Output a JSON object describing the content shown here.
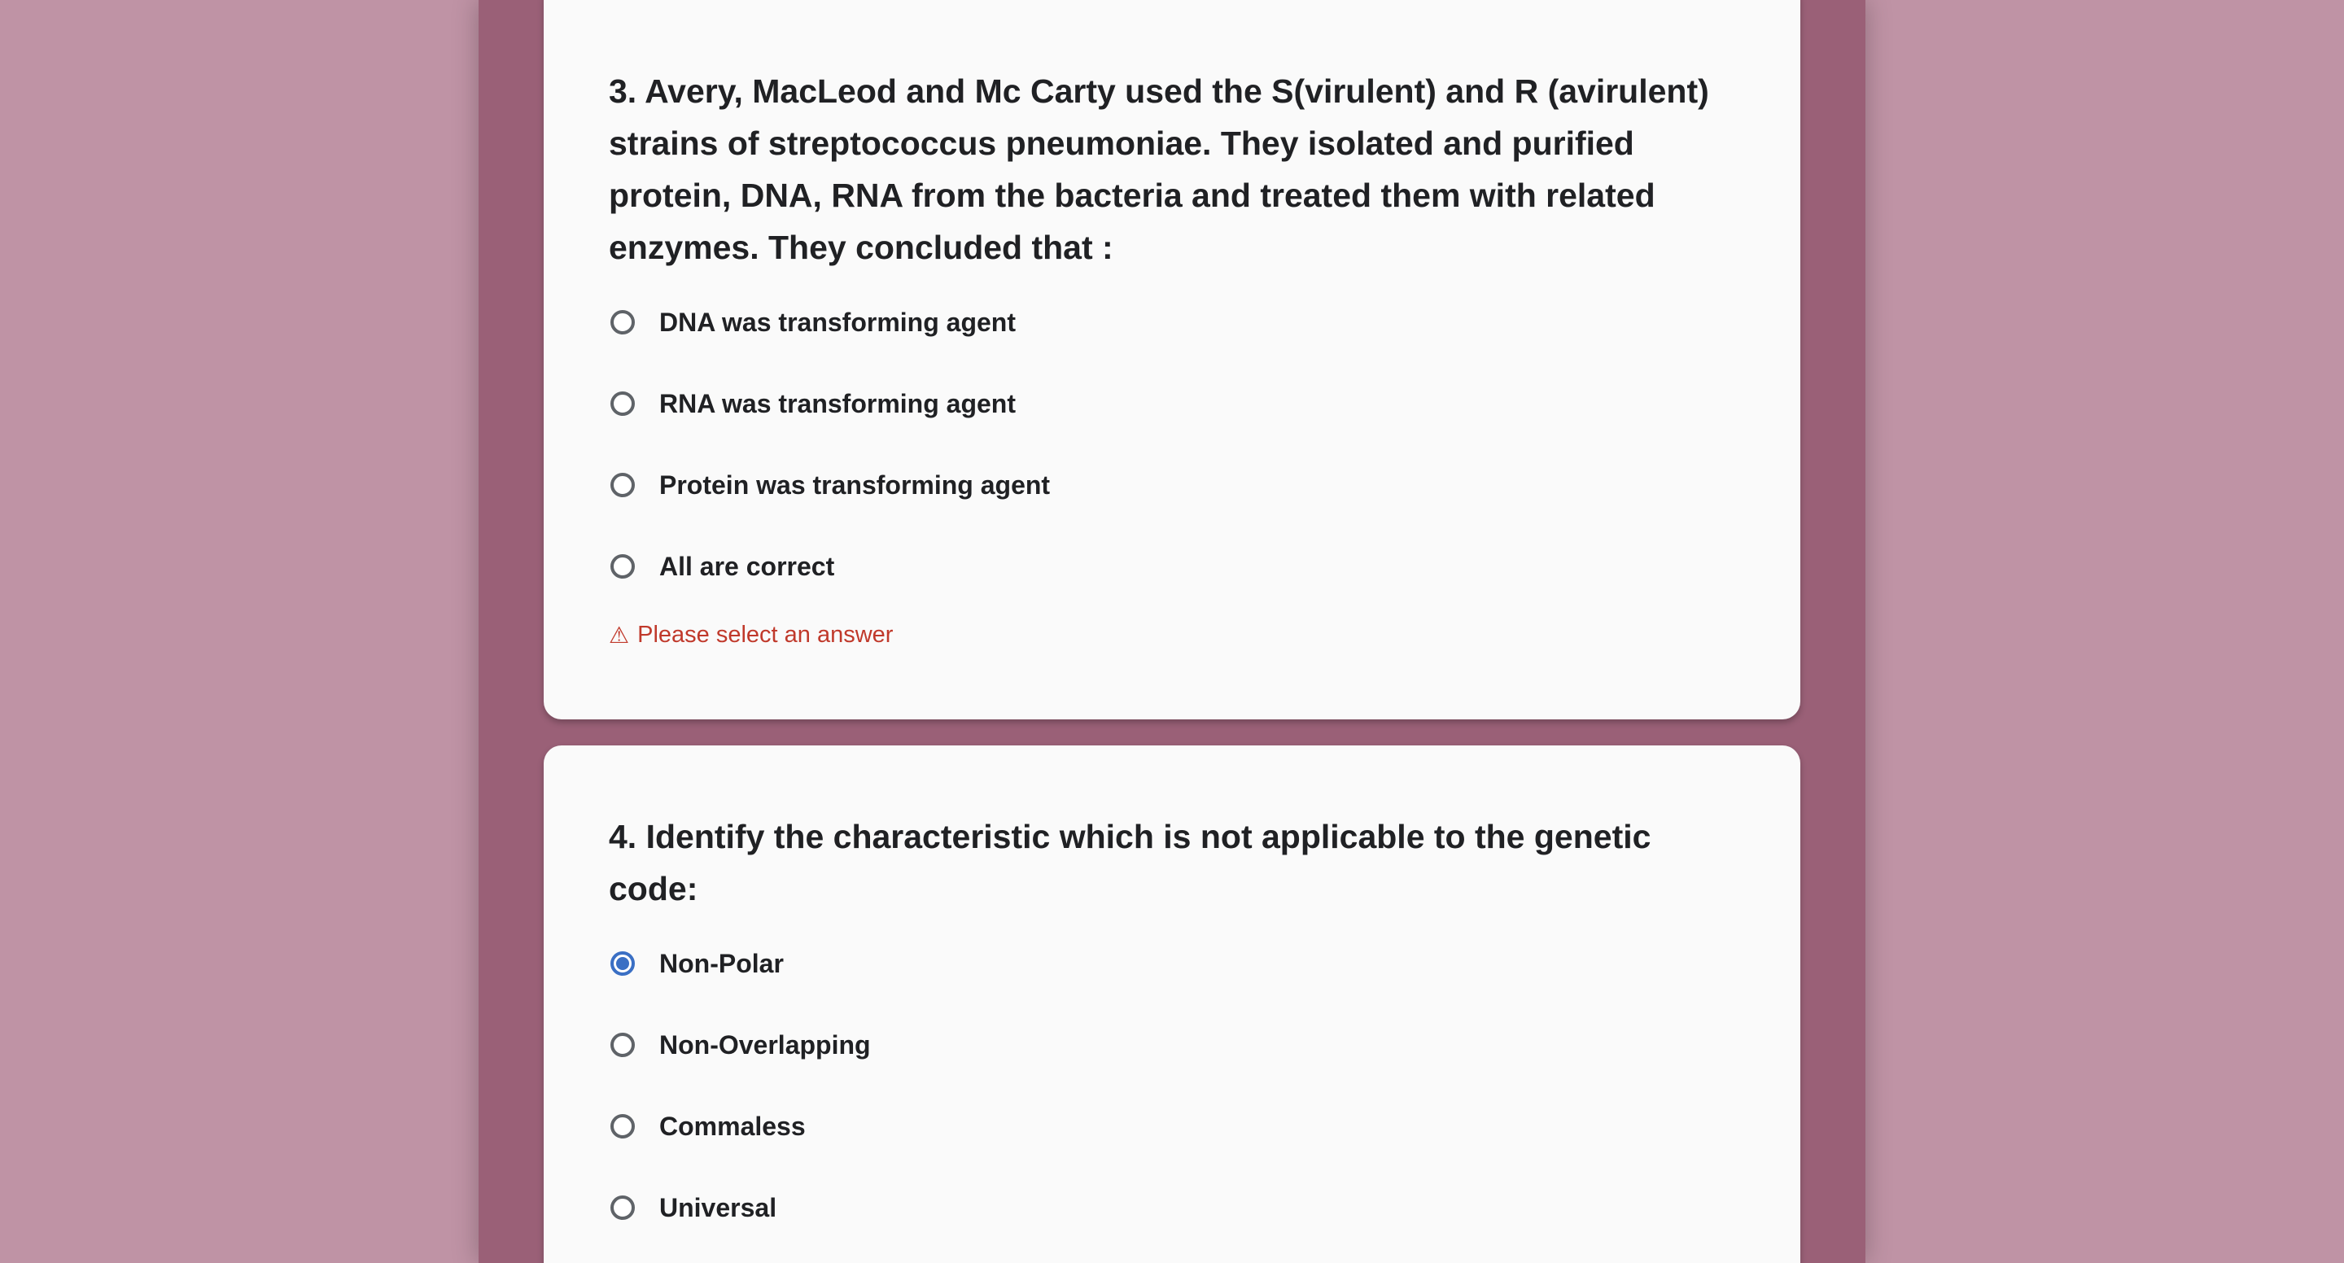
{
  "colors": {
    "page_background": "#bf93a5",
    "column_background": "#9a6077",
    "card_background": "#fafafa",
    "selected_radio": "#3a6fc4",
    "error_text": "#c0392b"
  },
  "questions": [
    {
      "text": "3. Avery, MacLeod and Mc Carty used the S(virulent) and R (avirulent) strains of streptococcus pneumoniae. They isolated and purified protein, DNA, RNA from the bacteria and treated them with related enzymes. They concluded that :",
      "options": [
        {
          "label": "DNA was transforming agent",
          "selected": false
        },
        {
          "label": "RNA was transforming agent",
          "selected": false
        },
        {
          "label": "Protein was transforming agent",
          "selected": false
        },
        {
          "label": "All are correct",
          "selected": false
        }
      ],
      "error": {
        "icon": "warning-icon",
        "glyph": "⚠",
        "text": "Please select an answer"
      }
    },
    {
      "text": "4. Identify the characteristic which is not applicable to the genetic code:",
      "options": [
        {
          "label": "Non-Polar",
          "selected": true
        },
        {
          "label": "Non-Overlapping",
          "selected": false
        },
        {
          "label": "Commaless",
          "selected": false
        },
        {
          "label": "Universal",
          "selected": false
        }
      ]
    }
  ]
}
